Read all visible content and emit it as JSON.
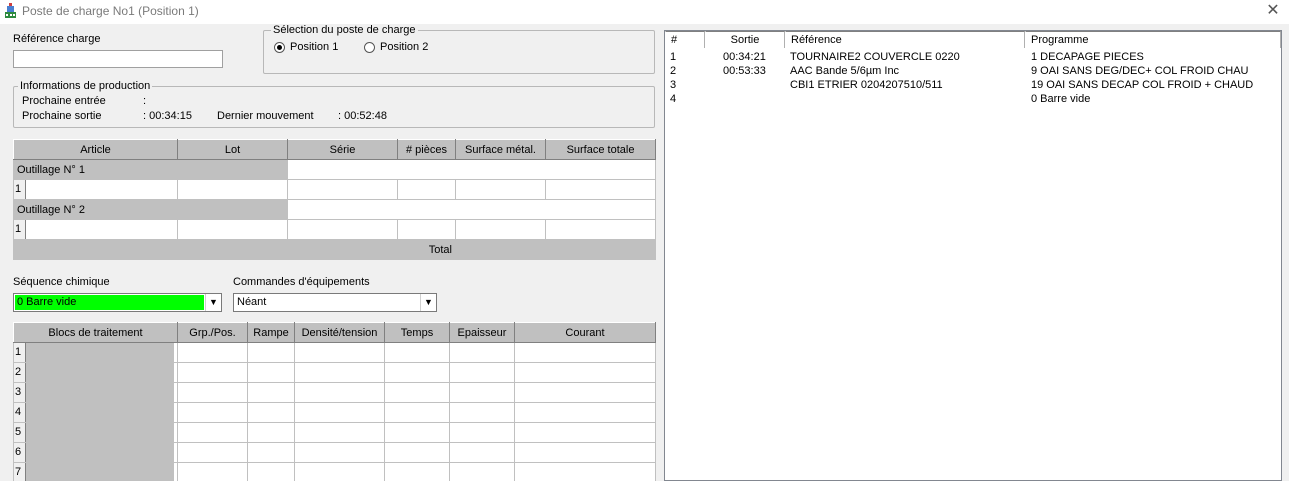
{
  "window": {
    "title": "Poste de charge No1 (Position 1)"
  },
  "reference_charge": {
    "label": "Référence charge",
    "value": ""
  },
  "selection": {
    "legend": "Sélection du poste de charge",
    "options": [
      {
        "label": "Position 1",
        "checked": true
      },
      {
        "label": "Position 2",
        "checked": false
      }
    ]
  },
  "production": {
    "legend": "Informations de production",
    "prochaine_entree_label": "Prochaine entrée",
    "prochaine_entree_value": ":",
    "prochaine_sortie_label": "Prochaine sortie",
    "prochaine_sortie_value": ": 00:34:15",
    "dernier_mouvement_label": "Dernier mouvement",
    "dernier_mouvement_value": ": 00:52:48"
  },
  "articles_table": {
    "headers": [
      "Article",
      "Lot",
      "Série",
      "# pièces",
      "Surface métal.",
      "Surface totale"
    ],
    "outillage1": "Outillage N° 1",
    "outillage2": "Outillage N° 2",
    "row1": "1",
    "row2": "1",
    "total_label": "Total"
  },
  "sequence": {
    "label": "Séquence chimique",
    "value": "0 Barre vide",
    "color": "#00ff00"
  },
  "commandes": {
    "label": "Commandes d'équipements",
    "value": "Néant"
  },
  "blocs_table": {
    "headers": [
      "Blocs de traitement",
      "Grp./Pos.",
      "Rampe",
      "Densité/tension",
      "Temps",
      "Epaisseur",
      "Courant"
    ],
    "rows": [
      "1",
      "2",
      "3",
      "4",
      "5",
      "6",
      "7"
    ]
  },
  "right_list": {
    "headers": [
      "#",
      "Sortie",
      "Référence",
      "Programme"
    ],
    "rows": [
      {
        "num": "1",
        "sortie": "00:34:21",
        "reference": "TOURNAIRE2 COUVERCLE 0220",
        "programme": "1 DECAPAGE PIECES"
      },
      {
        "num": "2",
        "sortie": "00:53:33",
        "reference": "AAC Bande 5/6µm Inc",
        "programme": "9 OAI SANS DEG/DEC+ COL FROID CHAU"
      },
      {
        "num": "3",
        "sortie": "",
        "reference": "CBI1 ETRIER 0204207510/511",
        "programme": "19 OAI SANS DECAP COL FROID + CHAUD"
      },
      {
        "num": "4",
        "sortie": "",
        "reference": "",
        "programme": "0 Barre vide"
      }
    ]
  },
  "icons": {
    "app": "app-icon",
    "close": "close-icon",
    "dropdown": "chevron-down-icon"
  }
}
